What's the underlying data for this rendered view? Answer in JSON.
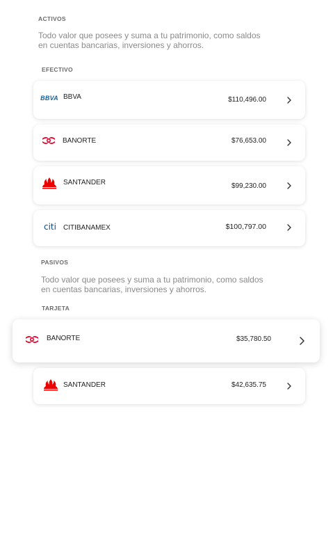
{
  "activos": {
    "title": "ACTIVOS",
    "description": "Todo valor que posees y suma a tu patrimonio, como saldos en cuentas bancarias, inversiones y ahorros.",
    "group_label": "EFECTIVO",
    "accounts": [
      {
        "bank": "BBVA",
        "amount": "$110,496.00",
        "logo": "bbva-logo",
        "logo_text": "BBVA"
      },
      {
        "bank": "BANORTE",
        "amount": "$76,653.00",
        "logo": "banorte-logo"
      },
      {
        "bank": "SANTANDER",
        "amount": "$99,230.00",
        "logo": "santander-logo"
      },
      {
        "bank": "CITIBANAMEX",
        "amount": "$100,797.00",
        "logo": "citi-logo",
        "logo_text": "citi"
      }
    ]
  },
  "pasivos": {
    "title": "PASIVOS",
    "description": "Todo valor que posees y suma a tu patrimonio, como saldos en cuentas bancarias, inversiones y ahorros.",
    "group_label": "TARJETA",
    "accounts": [
      {
        "bank": "BANORTE",
        "amount": "$35,780.50",
        "logo": "banorte-logo"
      },
      {
        "bank": "SANTANDER",
        "amount": "$42,635.75",
        "logo": "santander-logo"
      }
    ]
  },
  "colors": {
    "bbva": "#1464a5",
    "banorte": "#eb0029",
    "santander": "#ec0000",
    "citi": "#0a4a95"
  }
}
